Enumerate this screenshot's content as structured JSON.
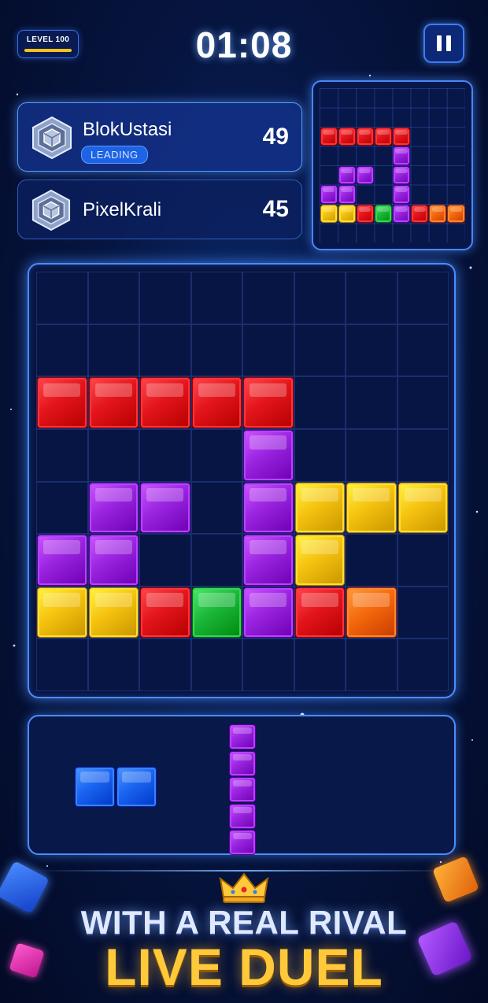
{
  "level": {
    "label": "LEVEL 100",
    "progress": 1.0
  },
  "timer": "01:08",
  "pause": {
    "icon": "pause-icon"
  },
  "players": [
    {
      "name": "BlokUstasi",
      "score": "49",
      "badge": "LEADING",
      "avatar": "hexagon-cube-icon"
    },
    {
      "name": "PixelKrali",
      "score": "45",
      "avatar": "hexagon-cube-icon"
    }
  ],
  "colors": {
    "red": "#e3151b",
    "purple": "#9a24e0",
    "yellow": "#f5c20f",
    "green": "#1ab73a",
    "orange": "#f5690d",
    "blue": "#1b64f2",
    "accent": "#4b8cff",
    "background": "#061540"
  },
  "opponent_board": {
    "cols": 8,
    "rows": 8,
    "blocks": [
      {
        "r": 2,
        "c": 0,
        "color": "red"
      },
      {
        "r": 2,
        "c": 1,
        "color": "red"
      },
      {
        "r": 2,
        "c": 2,
        "color": "red"
      },
      {
        "r": 2,
        "c": 3,
        "color": "red"
      },
      {
        "r": 2,
        "c": 4,
        "color": "red"
      },
      {
        "r": 3,
        "c": 4,
        "color": "purple"
      },
      {
        "r": 4,
        "c": 1,
        "color": "purple"
      },
      {
        "r": 4,
        "c": 2,
        "color": "purple"
      },
      {
        "r": 4,
        "c": 4,
        "color": "purple"
      },
      {
        "r": 5,
        "c": 0,
        "color": "purple"
      },
      {
        "r": 5,
        "c": 1,
        "color": "purple"
      },
      {
        "r": 5,
        "c": 4,
        "color": "purple"
      },
      {
        "r": 6,
        "c": 0,
        "color": "yellow"
      },
      {
        "r": 6,
        "c": 1,
        "color": "yellow"
      },
      {
        "r": 6,
        "c": 2,
        "color": "red"
      },
      {
        "r": 6,
        "c": 3,
        "color": "green"
      },
      {
        "r": 6,
        "c": 4,
        "color": "purple"
      },
      {
        "r": 6,
        "c": 5,
        "color": "red"
      },
      {
        "r": 6,
        "c": 6,
        "color": "orange"
      },
      {
        "r": 6,
        "c": 7,
        "color": "orange"
      }
    ]
  },
  "board": {
    "cols": 8,
    "rows": 8,
    "blocks": [
      {
        "r": 2,
        "c": 0,
        "color": "red"
      },
      {
        "r": 2,
        "c": 1,
        "color": "red"
      },
      {
        "r": 2,
        "c": 2,
        "color": "red"
      },
      {
        "r": 2,
        "c": 3,
        "color": "red"
      },
      {
        "r": 2,
        "c": 4,
        "color": "red"
      },
      {
        "r": 3,
        "c": 4,
        "color": "purple"
      },
      {
        "r": 4,
        "c": 1,
        "color": "purple"
      },
      {
        "r": 4,
        "c": 2,
        "color": "purple"
      },
      {
        "r": 4,
        "c": 4,
        "color": "purple"
      },
      {
        "r": 4,
        "c": 5,
        "color": "yellow"
      },
      {
        "r": 4,
        "c": 6,
        "color": "yellow"
      },
      {
        "r": 4,
        "c": 7,
        "color": "yellow"
      },
      {
        "r": 5,
        "c": 0,
        "color": "purple"
      },
      {
        "r": 5,
        "c": 1,
        "color": "purple"
      },
      {
        "r": 5,
        "c": 4,
        "color": "purple"
      },
      {
        "r": 5,
        "c": 5,
        "color": "yellow"
      },
      {
        "r": 6,
        "c": 0,
        "color": "yellow"
      },
      {
        "r": 6,
        "c": 1,
        "color": "yellow"
      },
      {
        "r": 6,
        "c": 2,
        "color": "red"
      },
      {
        "r": 6,
        "c": 3,
        "color": "green"
      },
      {
        "r": 6,
        "c": 4,
        "color": "purple"
      },
      {
        "r": 6,
        "c": 5,
        "color": "red"
      },
      {
        "r": 6,
        "c": 6,
        "color": "orange"
      }
    ]
  },
  "tray": {
    "pieces": [
      {
        "name": "blue-domino-piece",
        "color": "blue",
        "cells": [
          [
            0,
            0
          ],
          [
            0,
            1
          ]
        ]
      },
      {
        "name": "purple-i5-piece",
        "color": "purple",
        "cells": [
          [
            0,
            0
          ],
          [
            1,
            0
          ],
          [
            2,
            0
          ],
          [
            3,
            0
          ],
          [
            4,
            0
          ]
        ]
      }
    ]
  },
  "promo": {
    "line1": "WITH A REAL RIVAL",
    "line2": "LIVE DUEL",
    "crown": "crown-icon"
  }
}
